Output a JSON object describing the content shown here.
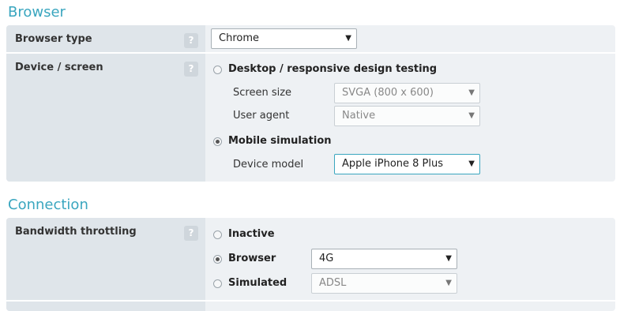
{
  "browser_section": {
    "title": "Browser",
    "browser_type": {
      "label": "Browser type",
      "help": "?",
      "value": "Chrome"
    },
    "device_screen": {
      "label": "Device / screen",
      "help": "?",
      "desktop_option": "Desktop / responsive design testing",
      "screen_size_label": "Screen size",
      "screen_size_value": "SVGA (800 x 600)",
      "user_agent_label": "User agent",
      "user_agent_value": "Native",
      "mobile_option": "Mobile simulation",
      "device_model_label": "Device model",
      "device_model_value": "Apple iPhone 8 Plus",
      "selected": "mobile"
    }
  },
  "connection_section": {
    "title": "Connection",
    "bandwidth": {
      "label": "Bandwidth throttling",
      "help": "?",
      "inactive_option": "Inactive",
      "browser_option": "Browser",
      "browser_value": "4G",
      "simulated_option": "Simulated",
      "simulated_value": "ADSL",
      "selected": "browser"
    }
  },
  "icons": {
    "dropdown": "chevron-down-icon",
    "help": "question-mark-icon"
  },
  "colors": {
    "accent": "#3aa6bf",
    "panel": "#eef1f4",
    "label_column": "#dfe5ea"
  }
}
